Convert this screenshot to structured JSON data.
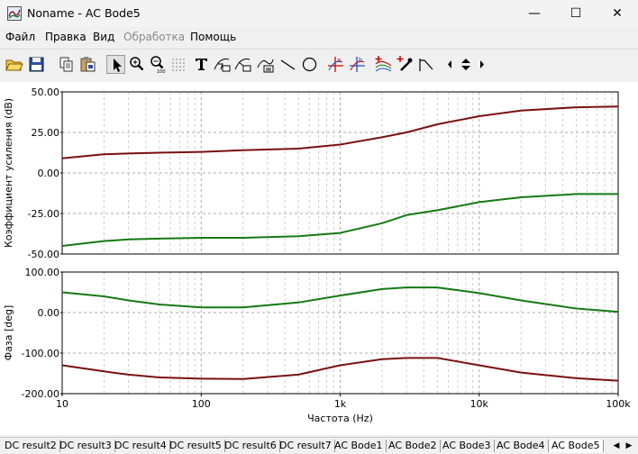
{
  "window": {
    "title": "Noname - AC Bode5",
    "minimize_glyph": "—",
    "maximize_glyph": "☐",
    "close_glyph": "✕"
  },
  "menu": [
    "Файл",
    "Правка",
    "Вид",
    "Обработка",
    "Помощь"
  ],
  "menu_disabled": [
    "Обработка"
  ],
  "toolbar": {
    "icons": [
      "open-folder-icon",
      "save-disk-icon",
      "copy-icon",
      "paste-icon",
      "pointer-icon",
      "zoom-in-icon",
      "zoom-out-icon",
      "grid-dots-icon",
      "text-tool-icon",
      "curve-label-icon",
      "curve-label-alt-icon",
      "equation-label-icon",
      "line-tool-icon",
      "circle-tool-icon",
      "cursor-a-icon",
      "cursor-b-icon",
      "add-curve-icon",
      "pick-color-icon",
      "bode-asymptote-icon",
      "scroll-left-icon",
      "scroll-updown-icon",
      "scroll-right-icon"
    ],
    "zoom_out_caption": "100"
  },
  "chart_data": [
    {
      "type": "line",
      "ylabel": "Коэффициент усиления (dB)",
      "xscale": "log",
      "xlim": [
        10,
        100000
      ],
      "ylim": [
        -50,
        50
      ],
      "yticks": [
        "50.00",
        "25.00",
        "0.00",
        "-25.00",
        "-50.00"
      ],
      "ytick_values": [
        50,
        25,
        0,
        -25,
        -50
      ],
      "grid": true,
      "series": [
        {
          "color": "#7a1010",
          "x": [
            10,
            20,
            30,
            50,
            100,
            200,
            500,
            1000,
            2000,
            3000,
            5000,
            10000,
            20000,
            50000,
            100000
          ],
          "y": [
            9,
            11.5,
            12,
            12.5,
            13,
            14,
            15,
            17.5,
            22,
            25,
            30,
            35,
            38.5,
            40.5,
            41
          ]
        },
        {
          "color": "#147a14",
          "x": [
            10,
            20,
            30,
            50,
            100,
            200,
            500,
            1000,
            2000,
            3000,
            5000,
            10000,
            20000,
            50000,
            100000
          ],
          "y": [
            -45,
            -42,
            -41,
            -40.5,
            -40,
            -40,
            -39,
            -37,
            -31,
            -26,
            -23,
            -18,
            -15,
            -13,
            -13
          ]
        }
      ]
    },
    {
      "type": "line",
      "ylabel": "Фаза [deg]",
      "xlabel": "Частота (Hz)",
      "xscale": "log",
      "xlim": [
        10,
        100000
      ],
      "ylim": [
        -200,
        100
      ],
      "yticks": [
        "100.00",
        "0.00",
        "-100.00",
        "-200.00"
      ],
      "ytick_values": [
        100,
        0,
        -100,
        -200
      ],
      "xticks": [
        "10",
        "100",
        "1k",
        "10k",
        "100k"
      ],
      "xtick_values": [
        10,
        100,
        1000,
        10000,
        100000
      ],
      "grid": true,
      "series": [
        {
          "color": "#147a14",
          "x": [
            10,
            20,
            30,
            50,
            100,
            200,
            500,
            1000,
            2000,
            3000,
            5000,
            10000,
            20000,
            50000,
            100000
          ],
          "y": [
            50,
            40,
            30,
            20,
            13,
            13,
            25,
            42,
            58,
            62,
            62,
            48,
            30,
            10,
            2
          ]
        },
        {
          "color": "#7a1010",
          "x": [
            10,
            20,
            30,
            50,
            100,
            200,
            500,
            1000,
            2000,
            3000,
            5000,
            10000,
            20000,
            50000,
            100000
          ],
          "y": [
            -130,
            -145,
            -153,
            -160,
            -163,
            -164,
            -153,
            -130,
            -115,
            -112,
            -112,
            -130,
            -148,
            -162,
            -168
          ]
        }
      ]
    }
  ],
  "tabs": [
    "DC result2",
    "DC result3",
    "DC result4",
    "DC result5",
    "DC result6",
    "DC result7",
    "AC Bode1",
    "AC Bode2",
    "AC Bode3",
    "AC Bode4",
    "AC Bode5"
  ],
  "active_tab": "AC Bode5",
  "tab_nav": [
    "◀",
    "▶"
  ]
}
